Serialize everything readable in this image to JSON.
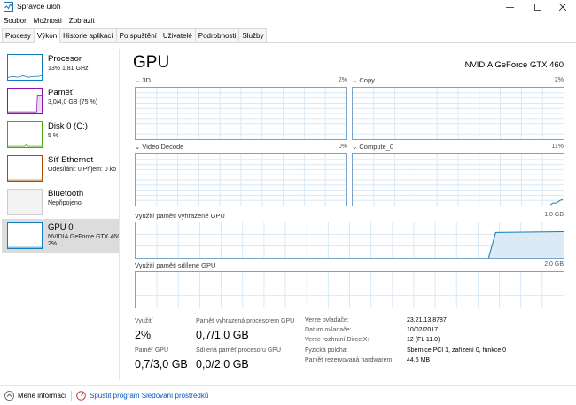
{
  "window": {
    "title": "Správce úloh"
  },
  "menu": [
    "Soubor",
    "Možnosti",
    "Zobrazit"
  ],
  "tabs": [
    "Procesy",
    "Výkon",
    "Historie aplikací",
    "Po spuštění",
    "Uživatelé",
    "Podrobnosti",
    "Služby"
  ],
  "active_tab": "Výkon",
  "sidebar": {
    "items": [
      {
        "title": "Procesor",
        "sub": "13%  1,81 GHz",
        "color": "#117dbb"
      },
      {
        "title": "Paměť",
        "sub": "3,0/4,0 GB (75 %)",
        "color": "#8b12ae"
      },
      {
        "title": "Disk 0 (C:)",
        "sub": "5 %",
        "color": "#4da60c"
      },
      {
        "title": "Síť Ethernet",
        "sub": "Odesílání: 0  Příjem: 0 kb",
        "color": "#a74f01"
      },
      {
        "title": "Bluetooth",
        "sub": "Nepřipojeno",
        "color": "#cccccc"
      },
      {
        "title": "GPU 0",
        "sub": "NVIDIA GeForce GTX 460",
        "sub2": "2%",
        "color": "#117dbb"
      }
    ]
  },
  "main": {
    "title": "GPU",
    "model": "NVIDIA GeForce GTX 460",
    "engines": [
      {
        "label": "3D",
        "pct": "2%"
      },
      {
        "label": "Copy",
        "pct": "2%"
      },
      {
        "label": "Video Decode",
        "pct": "0%"
      },
      {
        "label": "Compute_0",
        "pct": "11%"
      }
    ],
    "dedicated": {
      "label": "Využití paměti vyhrazené GPU",
      "max": "1,0 GB"
    },
    "shared": {
      "label": "Využití paměti sdílené GPU",
      "max": "2,0 GB"
    },
    "stats": {
      "util_label": "Využití",
      "util_value": "2%",
      "ded_label": "Paměť vyhrazená procesorem GPU",
      "ded_value": "0,7/1,0 GB",
      "mem_label": "Paměť GPU",
      "mem_value": "0,7/3,0 GB",
      "shr_label": "Sdílená paměť procesoru GPU",
      "shr_value": "0,0/2,0 GB"
    },
    "properties": [
      {
        "key": "Verze ovladače:",
        "value": "23.21.13.8787"
      },
      {
        "key": "Datum ovladače:",
        "value": "10/02/2017"
      },
      {
        "key": "Verze rozhraní DirectX:",
        "value": "12 (FL 11.0)"
      },
      {
        "key": "Fyzická poloha:",
        "value": "Sběrnice PCI 1, zařízení 0, funkce 0"
      },
      {
        "key": "Paměť rezervovaná hardwarem:",
        "value": "44,6 MB"
      }
    ]
  },
  "footer": {
    "less_info": "Méně informací",
    "monitor_link": "Spustit program Sledování prostředků"
  }
}
